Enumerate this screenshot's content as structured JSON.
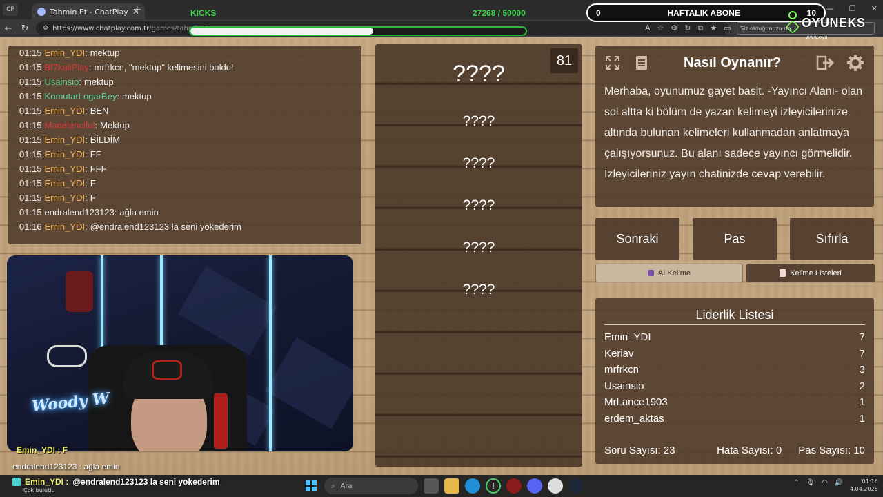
{
  "browser": {
    "tab_title": "Tahmin Et - ChatPlay",
    "tab_left_label": "CP",
    "url_host": "https://www.chatplay.com.tr",
    "url_path": "/games/tahminet",
    "saved_notice": "Siz olduğunuzu do..."
  },
  "kicks": {
    "label": "KICKS",
    "count": "27268 / 50000",
    "progress": 0.5454
  },
  "sub_goal": {
    "left": "0",
    "title": "HAFTALIK ABONE",
    "right": "10"
  },
  "brand": {
    "name": "OYUNEKS",
    "sub": "www.oyu"
  },
  "chat": [
    {
      "time": "01:15",
      "user": "Emin_YDI",
      "sep": ":",
      "msg": "mektup",
      "color": "orange"
    },
    {
      "time": "01:15",
      "user": "Bf7kaliPlay",
      "sep": ":",
      "msg": "mrfrkcn, \"mektup\" kelimesini buldu!",
      "color": "red"
    },
    {
      "time": "01:15",
      "user": "Usainsio",
      "sep": ":",
      "msg": "mektup",
      "color": "green"
    },
    {
      "time": "01:15",
      "user": "KomutarLogarBey",
      "sep": ":",
      "msg": "mektup",
      "color": "teal"
    },
    {
      "time": "01:15",
      "user": "Emin_YDI",
      "sep": ":",
      "msg": "BEN",
      "color": "orange"
    },
    {
      "time": "01:15",
      "user": "Madelenciful",
      "sep": ":",
      "msg": "Mektup",
      "color": "red"
    },
    {
      "time": "01:15",
      "user": "Emin_YDI",
      "sep": ":",
      "msg": "BİLDİM",
      "color": "orange"
    },
    {
      "time": "01:15",
      "user": "Emin_YDI",
      "sep": ":",
      "msg": "FF",
      "color": "orange"
    },
    {
      "time": "01:15",
      "user": "Emin_YDI",
      "sep": ":",
      "msg": "FFF",
      "color": "orange"
    },
    {
      "time": "01:15",
      "user": "Emin_YDI",
      "sep": ":",
      "msg": "F",
      "color": "orange"
    },
    {
      "time": "01:15",
      "user": "Emin_YDI",
      "sep": ":",
      "msg": "F",
      "color": "orange"
    },
    {
      "time": "01:15",
      "user": "endralend123123",
      "sep": ":",
      "msg": "ağla emin",
      "color": "white"
    },
    {
      "time": "01:16",
      "user": "Emin_YDI",
      "sep": ":",
      "msg": "@endralend123123 la seni yokederim",
      "color": "orange"
    }
  ],
  "overlay_chat": {
    "line1": "Emin_YDI : F",
    "line2": "endralend123123 : ağla emin",
    "line3_name": "Emin_YDI :",
    "line3_msg": "@endralend123123 la seni yokederim",
    "weather": "Çok bulutlu"
  },
  "webcam": {
    "neon_text": "Woody W"
  },
  "words": {
    "timer": "81",
    "items": [
      "????",
      "????",
      "????",
      "????",
      "????",
      "????"
    ]
  },
  "howto": {
    "title": "Nasıl Oynanır?",
    "text": "Merhaba, oyunumuz gayet basit. -Yayıncı Alanı- olan sol altta ki bölüm de yazan kelimeyi izleyicilerinize altında bulunan kelimeleri kullanmadan anlatmaya çalışıyorsunuz. Bu alanı sadece yayıncı görmelidir. İzleyicileriniz yayın chatinizde cevap verebilir."
  },
  "actions": {
    "next": "Sonraki",
    "pass": "Pas",
    "reset": "Sıfırla",
    "ai_word": "AI Kelime",
    "word_lists": "Kelime Listeleri"
  },
  "leaderboard": {
    "title": "Liderlik Listesi",
    "rows": [
      {
        "name": "Emin_YDI",
        "score": "7"
      },
      {
        "name": "Keriav",
        "score": "7"
      },
      {
        "name": "mrfrkcn",
        "score": "3"
      },
      {
        "name": "Usainsio",
        "score": "2"
      },
      {
        "name": "MrLance1903",
        "score": "1"
      },
      {
        "name": "erdem_aktas",
        "score": "1"
      }
    ],
    "stats": {
      "questions": "Soru Sayısı: 23",
      "errors": "Hata Sayısı: 0",
      "passes": "Pas Sayısı: 10"
    }
  },
  "taskbar": {
    "search_placeholder": "Ara",
    "time": "01:16",
    "date": "4.04.2026"
  },
  "colors": {
    "kicks_green": "#3cd64a",
    "panel_brown": "#4e3a2a",
    "username_orange": "#f0b35a",
    "username_green": "#5fd08a",
    "username_red": "#d43a3a"
  }
}
